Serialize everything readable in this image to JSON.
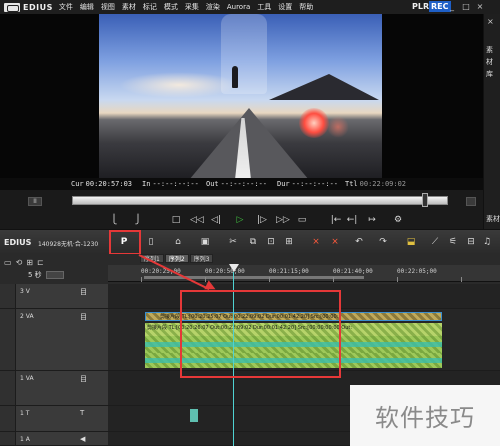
{
  "app": {
    "name": "EDIUS",
    "menu": [
      "文件",
      "编辑",
      "视图",
      "素材",
      "标记",
      "模式",
      "采集",
      "渲染",
      "Aurora",
      "工具",
      "设置",
      "帮助"
    ],
    "mode_plr": "PLR",
    "mode_rec": "REC",
    "window_controls": [
      "_",
      "□",
      "×"
    ]
  },
  "right_panel": {
    "close_glyph": "×",
    "label": "素材库",
    "bottom_label": "素材"
  },
  "monitor": {
    "timecodes": {
      "cur_label": "Cur",
      "cur": "00:20:57:03",
      "in_label": "In",
      "in": "--:--:--:--",
      "out_label": "Out",
      "out": "--:--:--:--",
      "dur_label": "Dur",
      "dur": "--:--:--:--",
      "ttl_label": "Ttl",
      "ttl": "00:22:09:02"
    },
    "scrub_position_fraction": 0.94
  },
  "toolbar": {
    "edius_label": "EDIUS",
    "project_name": "140928无机·合-1230",
    "p_button": "P"
  },
  "timeline": {
    "tabs": [
      "序列1",
      "序列2",
      "序列3"
    ],
    "active_tab": 1,
    "scale_label": "5 秒",
    "ruler_ticks": [
      "00:20:25;00",
      "00:20:50;00",
      "00:21:15;00",
      "00:21:40;00",
      "00:22:05;00"
    ],
    "tracks": [
      {
        "name": "3 V",
        "icon": "目"
      },
      {
        "name": "2 VA",
        "icon": "目"
      },
      {
        "name": "1 VA",
        "icon": "目"
      },
      {
        "name": "1 T",
        "icon": "T"
      },
      {
        "name": "1 A",
        "icon": "◀"
      }
    ],
    "clip_top_label": "剪接片段  TL:[00:20:25:07 Out:00:22:09:02 Dur:00:01:42:20]  Src:[00:00:",
    "clip_mid_label": "剪接片段  TL:[00:20:26:07 Out:00:22:09:02 Dur:00:01:42:20]  Src:[00:00:00:00 Out:"
  },
  "watermark": "软件技巧"
}
